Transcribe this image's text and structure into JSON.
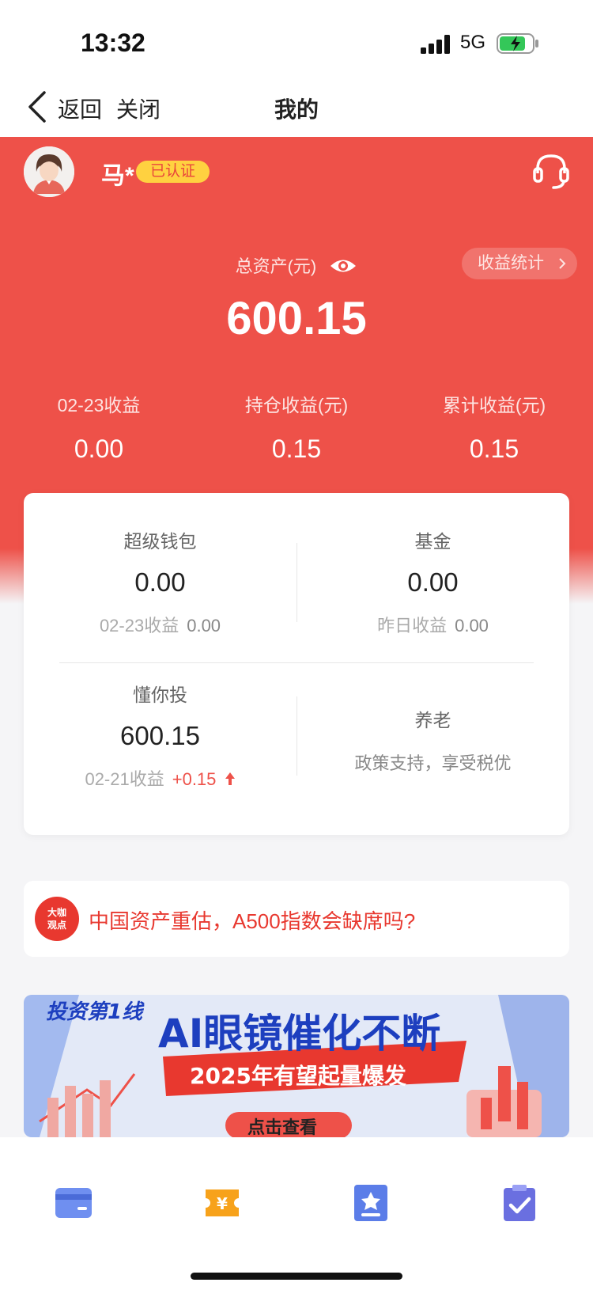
{
  "status_bar": {
    "time": "13:32",
    "network": "5G"
  },
  "nav": {
    "back_label": "返回",
    "close_label": "关闭",
    "title": "我的"
  },
  "user": {
    "name": "马*",
    "verified_badge": "已认证"
  },
  "assets": {
    "total_label": "总资产(元)",
    "total_value": "600.15",
    "stats_button": "收益统计"
  },
  "earnings": [
    {
      "label": "02-23收益",
      "value": "0.00"
    },
    {
      "label": "持仓收益(元)",
      "value": "0.15"
    },
    {
      "label": "累计收益(元)",
      "value": "0.15"
    }
  ],
  "products": {
    "super_wallet": {
      "title": "超级钱包",
      "value": "0.00",
      "sub_label": "02-23收益",
      "sub_value": "0.00"
    },
    "fund": {
      "title": "基金",
      "value": "0.00",
      "sub_label": "昨日收益",
      "sub_value": "0.00"
    },
    "dongnitou": {
      "title": "懂你投",
      "value": "600.15",
      "sub_label": "02-21收益",
      "sub_value": "+0.15"
    },
    "pension": {
      "title": "养老",
      "desc": "政策支持，享受税优"
    }
  },
  "news": {
    "badge_line1": "大咖",
    "badge_line2": "观点",
    "text": "中国资产重估，A500指数会缺席吗?"
  },
  "banner": {
    "brand": "投资第1线",
    "headline": "AI眼镜催化不断",
    "sub": "2025年有望起量爆发",
    "cta": "点击查看"
  },
  "tabbar": {
    "icons": [
      "card-icon",
      "coupon-icon",
      "bookmark-icon",
      "clipboard-check-icon"
    ]
  },
  "colors": {
    "primary_red": "#ee5149",
    "badge_yellow": "#ffd140",
    "tab_blue": "#5b7de8",
    "tab_orange": "#f7a21b"
  }
}
